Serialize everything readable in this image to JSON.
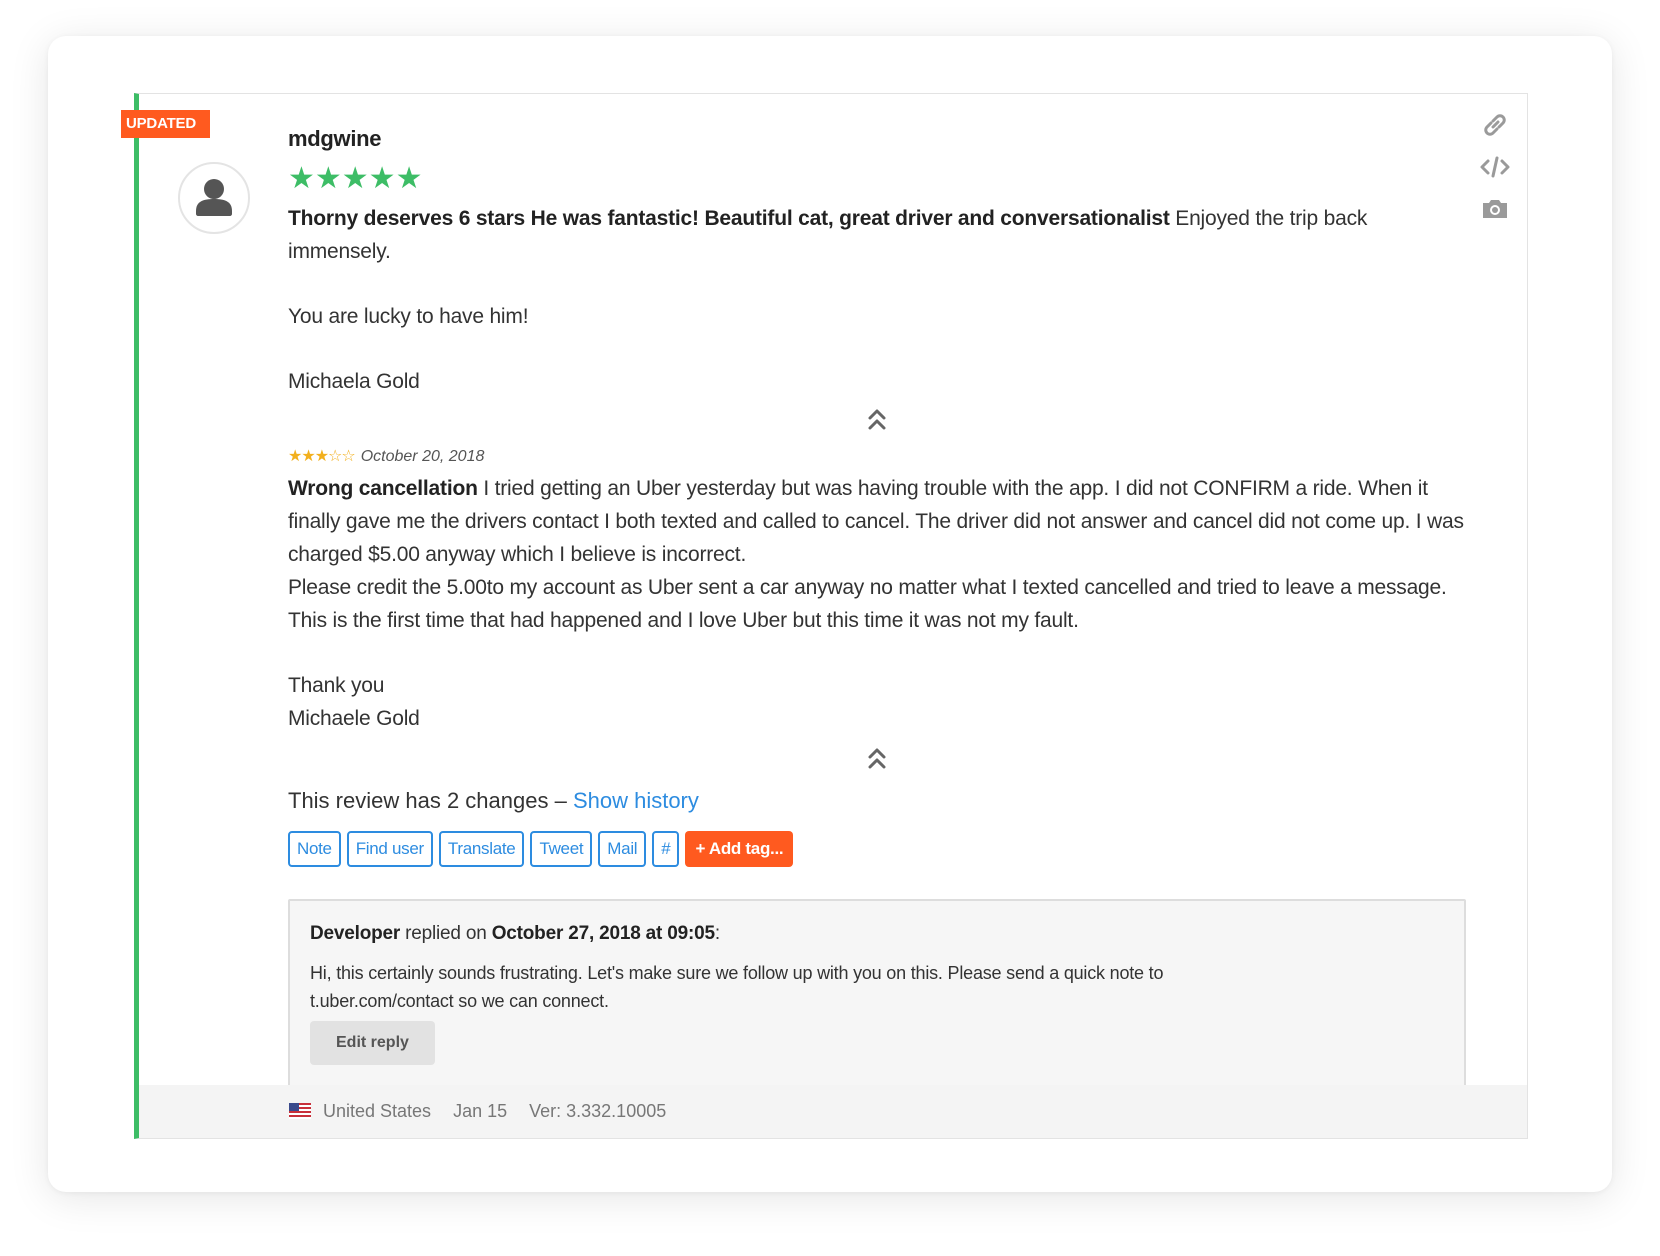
{
  "badge": "UPDATED",
  "review": {
    "author": "mdgwine",
    "stars": "★★★★★",
    "title": "Thorny deserves 6 stars He was fantastic! Beautiful cat, great driver and conversationalist",
    "body_line1_rest": " Enjoyed the trip back immensely.",
    "body_line2": "You are lucky to have him!",
    "body_line3": "Michaela Gold"
  },
  "previous_review": {
    "stars": "★★★☆☆",
    "date": "October 20, 2018",
    "title": "Wrong cancellation",
    "body_rest": " I tried getting an Uber yesterday but was having trouble with the app. I did not CONFIRM a ride. When it finally gave me the drivers contact I both texted and called to cancel. The driver did not answer and cancel did not come up. I was charged $5.00 anyway which I believe is incorrect.",
    "body_2": "Please credit the 5.00to my account as Uber sent a car anyway no matter what I texted cancelled and tried to leave a message. This is the first time that had happened and I love Uber but this time it was not my fault.",
    "body_3": "Thank you",
    "body_4": "Michaele Gold"
  },
  "history": {
    "text": "This review has 2 changes – ",
    "link": "Show history"
  },
  "actions": {
    "note": "Note",
    "find_user": "Find user",
    "translate": "Translate",
    "tweet": "Tweet",
    "mail": "Mail",
    "hash": "#",
    "add_tag": "+ Add tag..."
  },
  "reply": {
    "author": "Developer",
    "replied_on": " replied on ",
    "date": "October 27, 2018 at 09:05",
    "colon": ":",
    "text": "Hi, this certainly sounds frustrating. Let's make sure we follow up with you on this. Please send a quick note to t.uber.com/contact so we can connect.",
    "edit_button": "Edit reply"
  },
  "footer": {
    "country": "United States",
    "date": "Jan 15",
    "version_label": "Ver: ",
    "version": "3.332.10005"
  },
  "colors": {
    "accent_green": "#3dbd66",
    "badge_orange": "#ff5a1f",
    "link_blue": "#2d8ce0",
    "star_yellow": "#f2b01e"
  },
  "icons": [
    "link-icon",
    "embed-code-icon",
    "camera-icon",
    "user-avatar-icon",
    "collapse-chevron-icon",
    "us-flag-icon"
  ]
}
